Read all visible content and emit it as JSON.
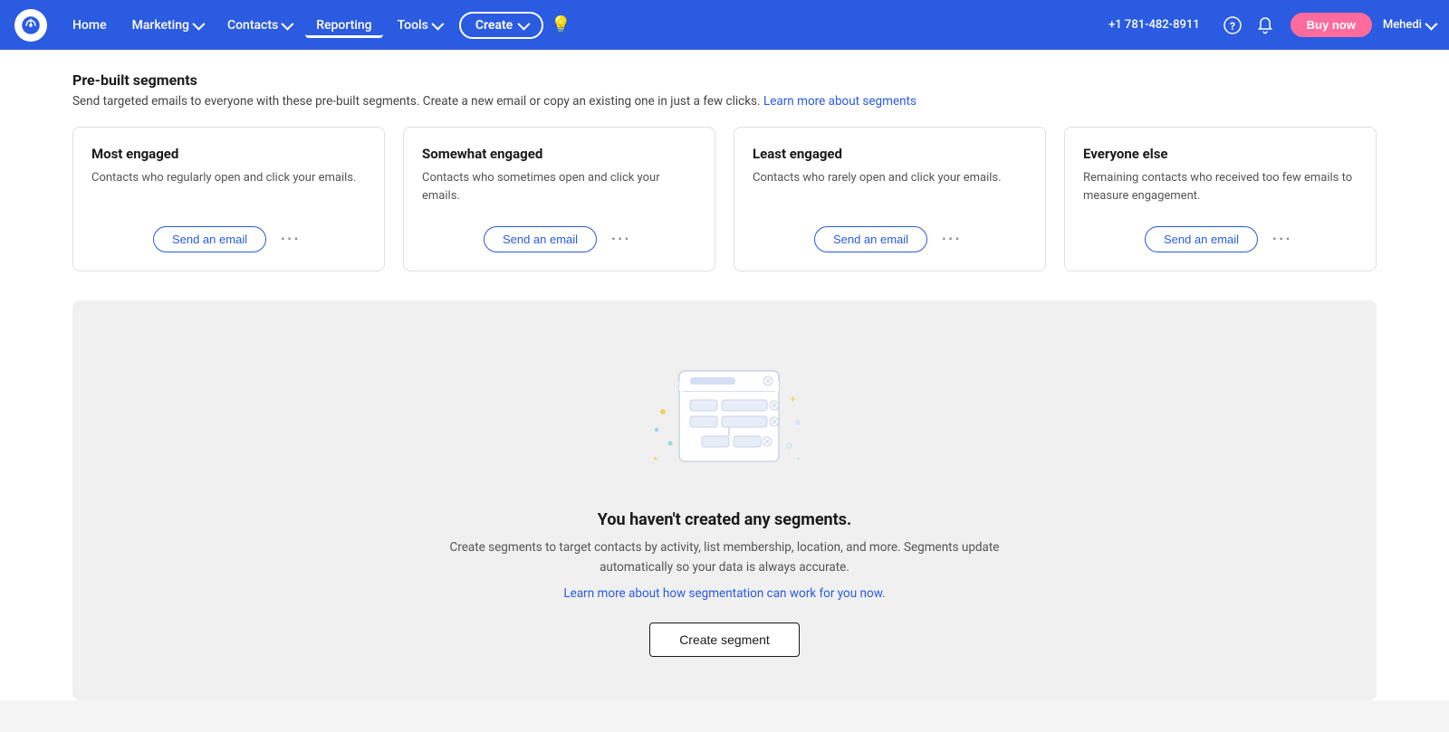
{
  "navbar": {
    "logo_alt": "Constant Contact logo",
    "nav_items": [
      {
        "label": "Home",
        "has_dropdown": false
      },
      {
        "label": "Marketing",
        "has_dropdown": true
      },
      {
        "label": "Contacts",
        "has_dropdown": true
      },
      {
        "label": "Reporting",
        "has_dropdown": false,
        "active": true
      },
      {
        "label": "Tools",
        "has_dropdown": true
      }
    ],
    "create_label": "Create",
    "phone": "+1 781-482-8911",
    "buy_now_label": "Buy now",
    "user_name": "Mehedi"
  },
  "prebuilt": {
    "title": "Pre-built segments",
    "description": "Send targeted emails to everyone with these pre-built segments. Create a new email or copy an existing one in just a few clicks.",
    "learn_more_label": "Learn more about segments",
    "cards": [
      {
        "title": "Most engaged",
        "description": "Contacts who regularly open and click your emails.",
        "send_label": "Send an email"
      },
      {
        "title": "Somewhat engaged",
        "description": "Contacts who sometimes open and click your emails.",
        "send_label": "Send an email"
      },
      {
        "title": "Least engaged",
        "description": "Contacts who rarely open and click your emails.",
        "send_label": "Send an email"
      },
      {
        "title": "Everyone else",
        "description": "Remaining contacts who received too few emails to measure engagement.",
        "send_label": "Send an email"
      }
    ]
  },
  "empty_state": {
    "title": "You haven't created any segments.",
    "description": "Create segments to target contacts by activity, list membership, location, and more. Segments update automatically so your data is always accurate.",
    "link_label": "Learn more about how segmentation can work for you now.",
    "create_label": "Create segment"
  }
}
